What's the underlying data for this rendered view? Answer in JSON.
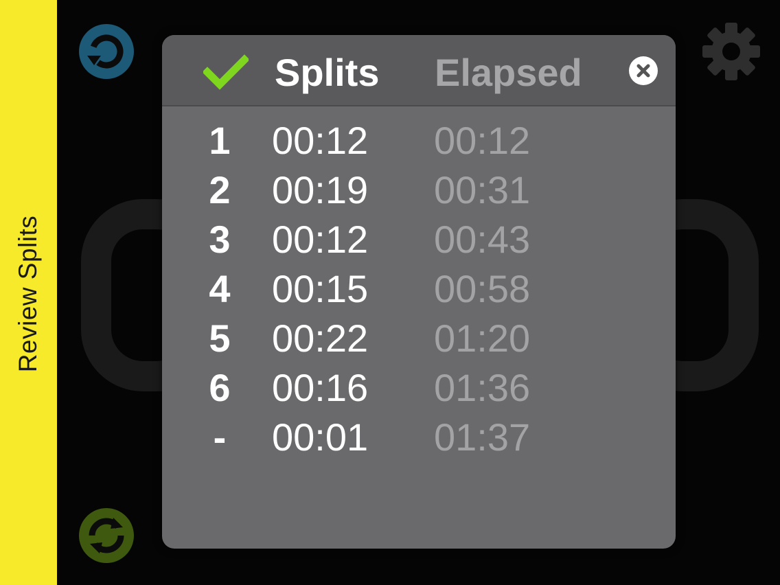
{
  "sidebar": {
    "label": "Review Splits"
  },
  "header": {
    "splits_tab": "Splits",
    "elapsed_tab": "Elapsed"
  },
  "icons": {
    "reset": "reset-icon",
    "settings": "gear-icon",
    "start": "start-stop-icon",
    "confirm": "checkmark-icon",
    "close": "close-icon"
  },
  "colors": {
    "sidebar": "#f6ea2a",
    "reset_icon": "#1d5a78",
    "start_icon": "#3f5a0e",
    "checkmark": "#7fd61e",
    "panel": "#6a6a6c",
    "header": "#5a5a5c",
    "gear": "#2e2e2e"
  },
  "splits": [
    {
      "num": "1",
      "split": "00:12",
      "elapsed": "00:12"
    },
    {
      "num": "2",
      "split": "00:19",
      "elapsed": "00:31"
    },
    {
      "num": "3",
      "split": "00:12",
      "elapsed": "00:43"
    },
    {
      "num": "4",
      "split": "00:15",
      "elapsed": "00:58"
    },
    {
      "num": "5",
      "split": "00:22",
      "elapsed": "01:20"
    },
    {
      "num": "6",
      "split": "00:16",
      "elapsed": "01:36"
    },
    {
      "num": "-",
      "split": "00:01",
      "elapsed": "01:37"
    }
  ]
}
